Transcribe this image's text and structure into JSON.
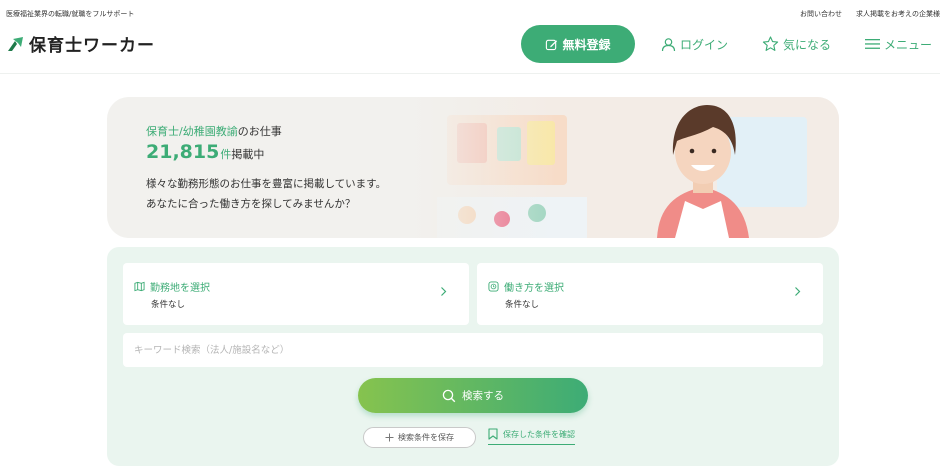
{
  "header": {
    "tagline": "医療福祉業界の転職/就職をフルサポート",
    "util_links": [
      "お問い合わせ",
      "求人掲載をお考えの企業様"
    ],
    "logo_text": "保育士ワーカー"
  },
  "nav": {
    "register_label": "無料登録",
    "login_label": "ログイン",
    "favorite_label": "気になる",
    "menu_label": "メニュー"
  },
  "hero": {
    "subtitle_accent": "保育士/幼稚園教諭",
    "subtitle_suffix": "のお仕事",
    "count": "21,815",
    "count_unit": "件",
    "count_suffix": "掲載中",
    "desc_line1": "様々な勤務形態のお仕事を豊富に掲載しています。",
    "desc_line2": "あなたに合った働き方を探してみませんか？"
  },
  "search": {
    "location": {
      "title": "勤務地を選択",
      "value": "条件なし"
    },
    "workstyle": {
      "title": "働き方を選択",
      "value": "条件なし"
    },
    "keyword_placeholder": "キーワード検索（法人/施設名など）",
    "keyword_value": "",
    "search_button": "検索する",
    "save_button": "検索条件を保存",
    "saved_link": "保存した条件を確認"
  },
  "colors": {
    "brand": "#3dac76",
    "panel_bg": "#eaf5ef",
    "hero_bg": "#f2f1ee"
  },
  "icons": {
    "register": "edit-icon",
    "login": "user-icon",
    "favorite": "star-icon",
    "menu": "hamburger-icon",
    "location": "map-icon",
    "workstyle": "clock-icon",
    "search": "search-icon",
    "save": "plus-icon",
    "saved": "bookmark-icon"
  }
}
